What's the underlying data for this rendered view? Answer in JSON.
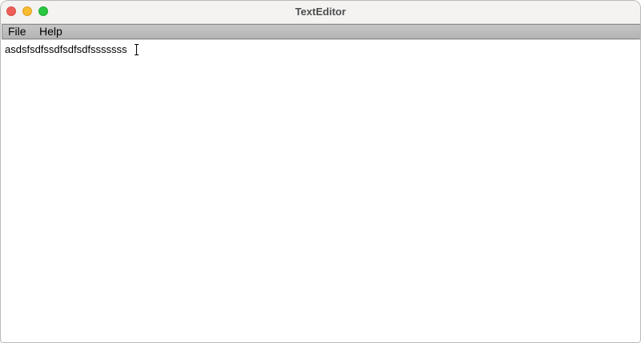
{
  "window": {
    "title": "TextEditor"
  },
  "menubar": {
    "items": [
      {
        "label": "File"
      },
      {
        "label": "Help"
      }
    ]
  },
  "editor": {
    "content": "asdsfsdfssdfsdfsdfsssssss"
  },
  "colors": {
    "close": "#ee5f58",
    "minimize": "#f8bc2f",
    "maximize": "#29c840",
    "menubar": "#bdbdbd"
  },
  "icons": {
    "caret": "text-cursor-icon"
  }
}
